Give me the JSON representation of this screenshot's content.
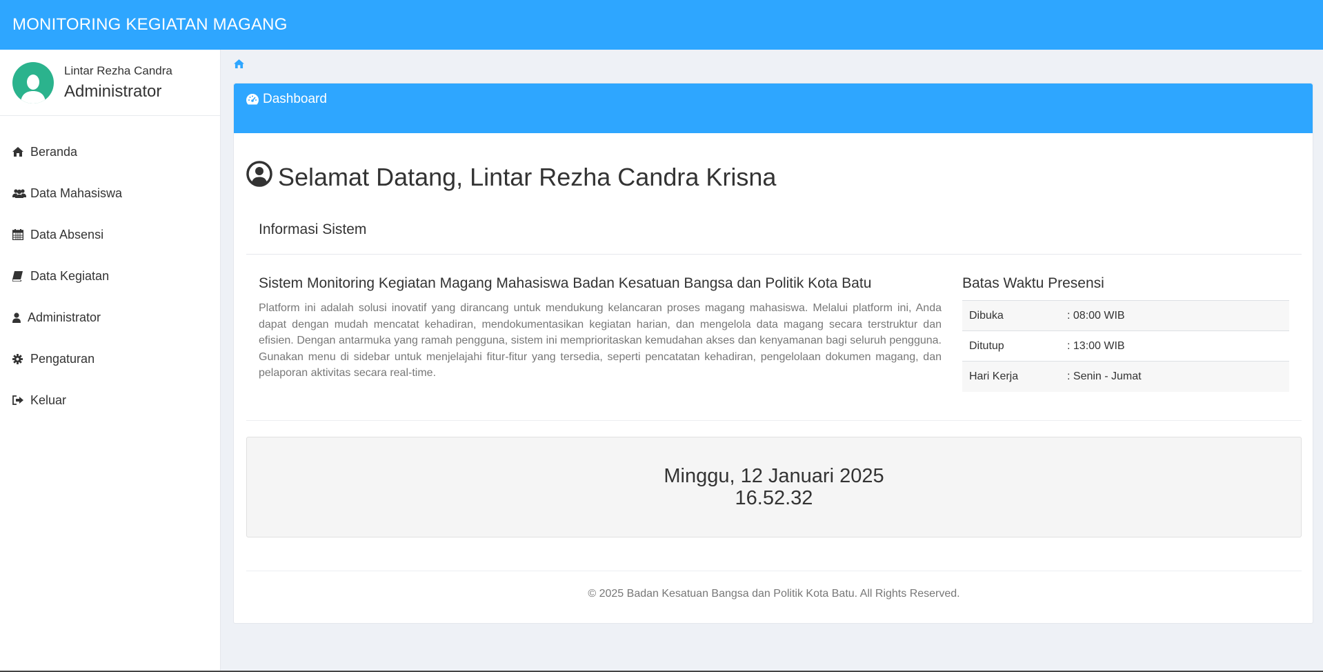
{
  "app": {
    "title": "MONITORING KEGIATAN MAGANG",
    "accent": "#2ea6ff",
    "avatar_color": "#2bb38d"
  },
  "user": {
    "name": "Lintar Rezha Candra",
    "role": "Administrator"
  },
  "sidebar": {
    "items": [
      {
        "label": "Beranda",
        "icon": "home-icon"
      },
      {
        "label": "Data Mahasiswa",
        "icon": "users-icon"
      },
      {
        "label": "Data Absensi",
        "icon": "calendar-icon"
      },
      {
        "label": "Data Kegiatan",
        "icon": "book-icon"
      },
      {
        "label": "Administrator",
        "icon": "user-icon"
      },
      {
        "label": "Pengaturan",
        "icon": "gear-icon"
      },
      {
        "label": "Keluar",
        "icon": "sign-out-icon"
      }
    ]
  },
  "breadcrumb": {
    "icon": "home-icon"
  },
  "panel": {
    "title": "Dashboard",
    "icon": "dashboard-icon"
  },
  "welcome": {
    "text": "Selamat Datang, Lintar Rezha Candra Krisna",
    "icon": "user-circle-icon"
  },
  "info": {
    "title": "Informasi Sistem",
    "system_title": "Sistem Monitoring Kegiatan Magang Mahasiswa Badan Kesatuan Bangsa dan Politik Kota Batu",
    "description": "Platform ini adalah solusi inovatif yang dirancang untuk mendukung kelancaran proses magang mahasiswa. Melalui platform ini, Anda dapat dengan mudah mencatat kehadiran, mendokumentasikan kegiatan harian, dan mengelola data magang secara terstruktur dan efisien. Dengan antarmuka yang ramah pengguna, sistem ini memprioritaskan kemudahan akses dan kenyamanan bagi seluruh pengguna. Gunakan menu di sidebar untuk menjelajahi fitur-fitur yang tersedia, seperti pencatatan kehadiran, pengelolaan dokumen magang, dan pelaporan aktivitas secara real-time."
  },
  "presensi": {
    "title": "Batas Waktu Presensi",
    "rows": [
      {
        "label": "Dibuka",
        "value": ": 08:00 WIB"
      },
      {
        "label": "Ditutup",
        "value": ": 13:00 WIB"
      },
      {
        "label": "Hari Kerja",
        "value": ": Senin - Jumat"
      }
    ]
  },
  "clock": {
    "date": "Minggu, 12 Januari 2025",
    "time": "16.52.32"
  },
  "footer": {
    "text": "© 2025 Badan Kesatuan Bangsa dan Politik Kota Batu. All Rights Reserved."
  }
}
